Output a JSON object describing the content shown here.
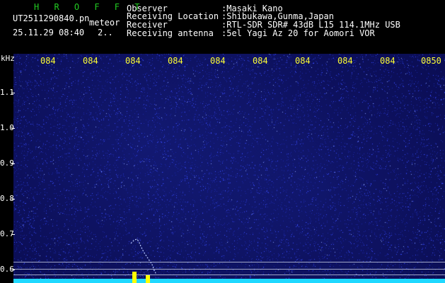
{
  "header": {
    "app_name": "H R O F F T",
    "file_name": "UT2511290840.pn",
    "event_type": "meteor",
    "date_time": "25.11.29 08:40",
    "count": "2..",
    "info": [
      {
        "label": "Observer",
        "value": ":Masaki Kano"
      },
      {
        "label": "Receiving Location",
        "value": ":Shibukawa,Gunma,Japan"
      },
      {
        "label": "Receiver",
        "value": ":RTL-SDR SDR# 43dB L15 114.1MHz USB"
      },
      {
        "label": "Receiving antenna",
        "value": ":5el Yagi Az 20 for Aomori VOR"
      }
    ]
  },
  "time_axis": {
    "ticks": [
      "084",
      "084",
      "084",
      "084",
      "084",
      "084",
      "084",
      "084",
      "084",
      "0850"
    ]
  },
  "freq_axis": {
    "unit": "kHz",
    "labels": [
      "1.1",
      "1.0",
      "0.9",
      "0.8",
      "0.7",
      "0.6"
    ]
  },
  "colors": {
    "background": "#000000",
    "waterfall": "#0a0c52",
    "speckle": "#3a4dff",
    "spectrum": "#1fd8ff",
    "tick_text": "#ffff33",
    "title_green": "#22cc22",
    "meteor_echo": "#b8c8ff",
    "spike": "#ffff00"
  }
}
